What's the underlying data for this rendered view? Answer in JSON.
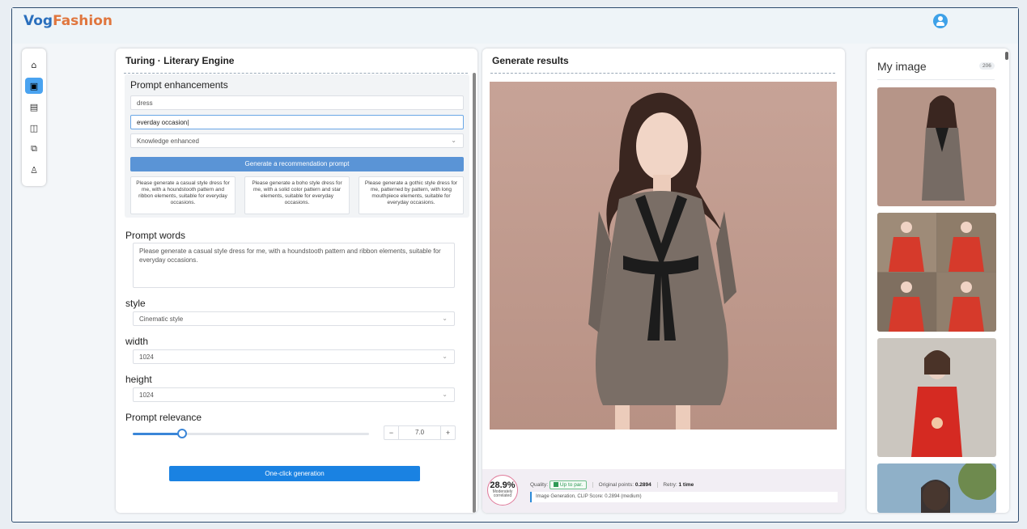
{
  "app": {
    "logo_part1": "Vog",
    "logo_part2": "Fashion"
  },
  "sidenav": {
    "items": [
      {
        "icon": "home-icon",
        "glyph": "⌂"
      },
      {
        "icon": "image-gen-icon",
        "glyph": "▣"
      },
      {
        "icon": "gallery-icon",
        "glyph": "▤"
      },
      {
        "icon": "layers-icon",
        "glyph": "◫"
      },
      {
        "icon": "copy-icon",
        "glyph": "⧉"
      },
      {
        "icon": "user-settings-icon",
        "glyph": "♙"
      }
    ]
  },
  "left": {
    "title": "Turing · Literary Engine",
    "enhancements": {
      "title": "Prompt enhancements",
      "input1_value": "dress",
      "input2_value": "everday occasion",
      "mode_value": "Knowledge enhanced",
      "generate_label": "Generate a recommendation prompt",
      "suggestions": [
        "Please generate a casual style dress for me, with a houndstooth pattern and ribbon elements, suitable for everyday occasions.",
        "Please generate a boho style dress for me, with a solid color pattern and star elements, suitable for everyday occasions.",
        "Please generate a gothic style dress for me, patterned by pattern, with long mouthpiece elements, suitable for everyday occasions."
      ]
    },
    "prompt_label": "Prompt words",
    "prompt_value": "Please generate a casual style dress for me, with a houndstooth pattern and ribbon elements, suitable for everyday occasions.",
    "style_label": "style",
    "style_value": "Cinematic style",
    "width_label": "width",
    "width_value": "1024",
    "height_label": "height",
    "height_value": "1024",
    "relevance_label": "Prompt relevance",
    "relevance_value": "7.0",
    "relevance_fraction": 0.21,
    "stepper_minus": "−",
    "stepper_plus": "+",
    "generate_button": "One-click generation"
  },
  "middle": {
    "title": "Generate results",
    "score_pct": "28.9%",
    "score_sub": "Moderately correlated",
    "quality_label": "Quality:",
    "quality_badge": "Up to par.",
    "original_points_label": "Original points:",
    "original_points_value": "0.2894",
    "retry_label": "Retry:",
    "retry_value": "1 time",
    "clip_text": "Image Generation, CLIP Score: 0.2894 (medium)"
  },
  "right": {
    "title": "My image",
    "count": "206"
  },
  "colors": {
    "accent": "#1a82e2",
    "logo_blue": "#2a6fbd",
    "logo_orange": "#e0763e"
  }
}
